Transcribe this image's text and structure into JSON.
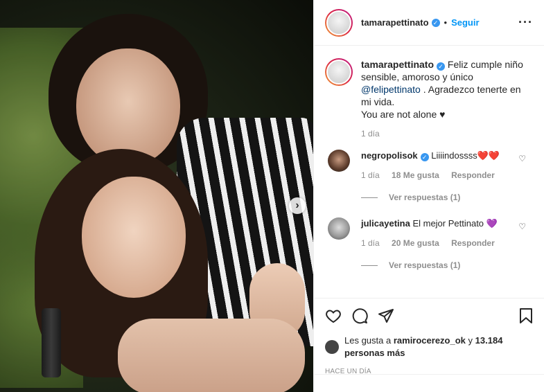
{
  "post": {
    "username": "tamarapettinato",
    "verified_mark": "✓",
    "dot": "•",
    "follow_label": "Seguir",
    "more_label": "···"
  },
  "caption": {
    "username": "tamarapettinato",
    "text_before": "Feliz cumple niño sensible, amoroso y único",
    "mention": "@felipettinato",
    "text_after": ". Agradezco tenerte en mi vida.",
    "line2": "You are not alone ♥",
    "time": "1 día"
  },
  "comments": [
    {
      "username": "negropolisok",
      "verified": true,
      "text": "Liiiindossss",
      "emoji": "❤️❤️",
      "time": "1 día",
      "likes": "18 Me gusta",
      "reply_label": "Responder",
      "replies_label": "Ver respuestas (1)"
    },
    {
      "username": "julicayetina",
      "verified": false,
      "text": "El mejor Pettinato",
      "emoji": "💜",
      "time": "1 día",
      "likes": "20 Me gusta",
      "reply_label": "Responder",
      "replies_label": "Ver respuestas (1)"
    }
  ],
  "likes": {
    "prefix": "Les gusta a",
    "user": "ramirocerezo_ok",
    "connector": "y",
    "others": "13.184 personas más"
  },
  "timestamp": "HACE UN DÍA",
  "icons": {
    "like": "heart-icon",
    "comment": "comment-icon",
    "share": "share-icon",
    "save": "bookmark-icon",
    "next": "chevron-right-icon"
  },
  "colors": {
    "accent": "#0095f6",
    "verified": "#3897f0",
    "muted": "#8e8e8e",
    "text": "#262626"
  }
}
